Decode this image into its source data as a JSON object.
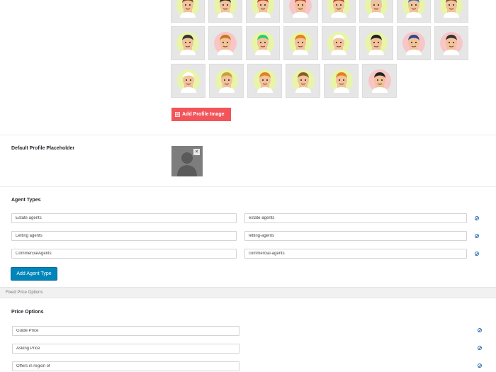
{
  "avatars": {
    "rows": [
      [
        {
          "icon": "avatar-face-icon",
          "skin": "#f2c29b",
          "hair": "#7a4a2a",
          "bg": "#e8f5a8"
        },
        {
          "icon": "avatar-face-icon",
          "skin": "#f2c29b",
          "hair": "#222222",
          "bg": "#e8f5a8"
        },
        {
          "icon": "avatar-face-icon",
          "skin": "#f2c29b",
          "hair": "#c0392b",
          "bg": "#e8f5a8"
        },
        {
          "icon": "avatar-face-icon",
          "skin": "#f2c29b",
          "hair": "#c0392b",
          "bg": "#f8c6c6"
        },
        {
          "icon": "avatar-face-icon",
          "skin": "#f2c29b",
          "hair": "#c0392b",
          "bg": "#e8f5a8"
        },
        {
          "icon": "avatar-face-icon",
          "skin": "#f2c29b",
          "hair": "#cccccc",
          "bg": "#e8f5a8"
        },
        {
          "icon": "avatar-face-icon",
          "skin": "#f2c29b",
          "hair": "#2e6fb3",
          "bg": "#e8f5a8"
        },
        {
          "icon": "avatar-face-icon",
          "skin": "#f2c29b",
          "hair": "#7a4a2a",
          "bg": "#e8f5a8"
        }
      ],
      [
        {
          "icon": "pilot-avatar-icon",
          "skin": "#f2c29b",
          "hair": "#333333",
          "bg": "#e8f5a8"
        },
        {
          "icon": "cowboy-avatar-icon",
          "skin": "#f2c29b",
          "hair": "#c8781e",
          "bg": "#f8c6c6"
        },
        {
          "icon": "avatar-face-icon",
          "skin": "#f2c29b",
          "hair": "#2ecc71",
          "bg": "#e8f5a8"
        },
        {
          "icon": "avatar-face-icon",
          "skin": "#f2c29b",
          "hair": "#e67e22",
          "bg": "#e8f5a8"
        },
        {
          "icon": "sailor-avatar-icon",
          "skin": "#f2c29b",
          "hair": "#ffffff",
          "bg": "#e8f5a8"
        },
        {
          "icon": "avatar-face-icon",
          "skin": "#f2c29b",
          "hair": "#222222",
          "bg": "#e8f5a8"
        },
        {
          "icon": "police-avatar-icon",
          "skin": "#f2c29b",
          "hair": "#2e4a8b",
          "bg": "#f8c6c6"
        },
        {
          "icon": "helmet-avatar-icon",
          "skin": "#f2c29b",
          "hair": "#333333",
          "bg": "#f8c6c6"
        }
      ],
      [
        {
          "icon": "chef-avatar-icon",
          "skin": "#f2c29b",
          "hair": "#ffffff",
          "bg": "#e8f5a8"
        },
        {
          "icon": "avatar-face-icon",
          "skin": "#f2c29b",
          "hair": "#c8a03a",
          "bg": "#e8f5a8"
        },
        {
          "icon": "builder-avatar-icon",
          "skin": "#f2c29b",
          "hair": "#e67e22",
          "bg": "#e8f5a8"
        },
        {
          "icon": "cowboy-avatar-icon",
          "skin": "#f2c29b",
          "hair": "#8b5a2b",
          "bg": "#e8f5a8"
        },
        {
          "icon": "avatar-face-icon",
          "skin": "#f2c29b",
          "hair": "#e67e22",
          "bg": "#e8f5a8"
        },
        {
          "icon": "avatar-face-icon",
          "skin": "#f2c29b",
          "hair": "#222222",
          "bg": "#f8c6c6"
        }
      ]
    ],
    "add_button_icon": "image-list-icon",
    "add_button_label": "Add Profile Image"
  },
  "placeholder": {
    "label": "Default Profile Placeholder",
    "remove_icon": "close-icon",
    "remove_glyph": "×"
  },
  "agent_types": {
    "title": "Agent Types",
    "rows": [
      {
        "name": "Estate agents",
        "slug": "estate-agents"
      },
      {
        "name": "Letting agents",
        "slug": "letting-agents"
      },
      {
        "name": "CommercialAgents",
        "slug": "commercial-agents"
      }
    ],
    "delete_icon": "remove-circle-icon",
    "add_label": "Add Agent Type"
  },
  "fixed_price_band": {
    "label": "Fixed Price Options"
  },
  "price_options": {
    "title": "Price Options",
    "rows": [
      "Guide Price",
      "Asking Price",
      "Offers in region of"
    ]
  },
  "colors": {
    "primary_button": "#0085ba",
    "danger_button": "#f3545a",
    "link_icon": "#2e6fb3"
  }
}
